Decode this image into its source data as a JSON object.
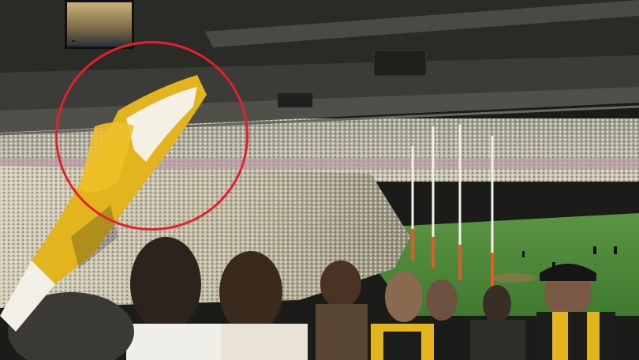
{
  "scene": {
    "tv_scoreboard_text": "",
    "colors": {
      "annotation_circle": "#e3202b",
      "pitch_grass": "#4f8a3a",
      "team_yellow": "#e2b51e",
      "team_black": "#1c1c1a"
    },
    "icons": [
      "tv-screen-icon",
      "speaker-icon",
      "goal-post-icon",
      "flag-icon"
    ]
  }
}
